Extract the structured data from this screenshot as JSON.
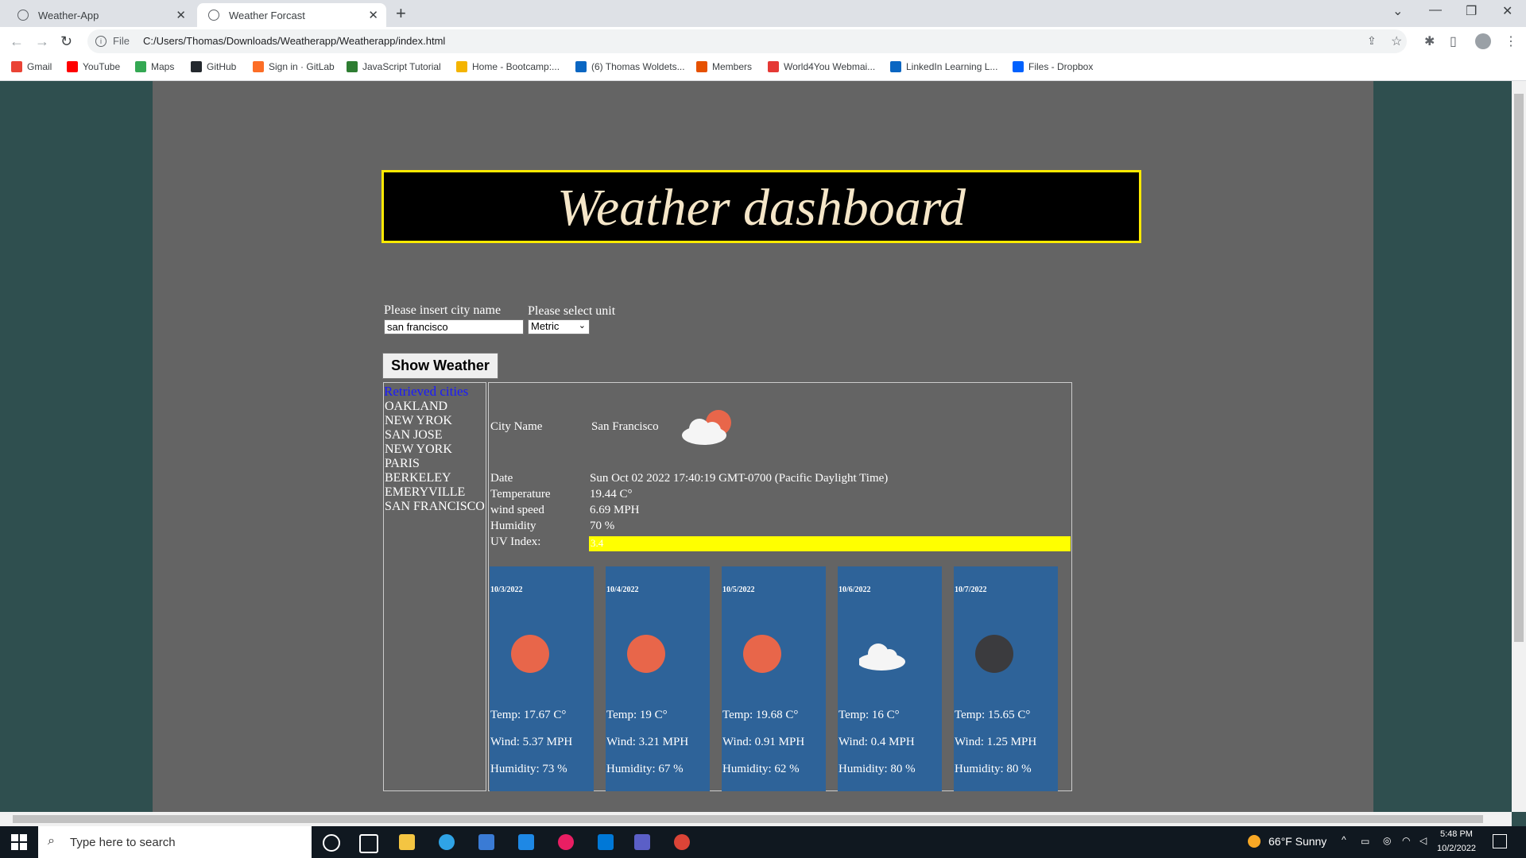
{
  "browser": {
    "tabs": [
      {
        "title": "Weather-App"
      },
      {
        "title": "Weather Forcast"
      }
    ],
    "url_scheme": "File",
    "url": "C:/Users/Thomas/Downloads/Weatherapp/Weatherapp/index.html",
    "bookmarks": [
      {
        "label": "Gmail",
        "color": "#ea4335"
      },
      {
        "label": "YouTube",
        "color": "#ff0000"
      },
      {
        "label": "Maps",
        "color": "#34a853"
      },
      {
        "label": "GitHub",
        "color": "#24292e"
      },
      {
        "label": "Sign in · GitLab",
        "color": "#fc6d26"
      },
      {
        "label": "JavaScript Tutorial",
        "color": "#2e7d32"
      },
      {
        "label": "Home - Bootcamp:...",
        "color": "#f4b400"
      },
      {
        "label": "(6) Thomas Woldets...",
        "color": "#0a66c2"
      },
      {
        "label": "Members",
        "color": "#e65100"
      },
      {
        "label": "World4You Webmai...",
        "color": "#e53935"
      },
      {
        "label": "LinkedIn Learning L...",
        "color": "#0a66c2"
      },
      {
        "label": "Files - Dropbox",
        "color": "#0061fe"
      }
    ]
  },
  "app": {
    "title": "Weather dashboard",
    "city_label": "Please insert city name",
    "city_value": "san francisco",
    "unit_label": "Please select unit",
    "unit_value": "Metric",
    "show_button": "Show Weather",
    "cities_heading": "Retrieved cities",
    "cities": [
      "OAKLAND",
      "NEW YROK",
      "SAN JOSE",
      "NEW YORK",
      "PARIS",
      "BERKELEY",
      "EMERYVILLE",
      "SAN FRANCISCO"
    ],
    "current": {
      "city_label": "City Name",
      "city": "San Francisco",
      "date_label": "Date",
      "date": "Sun Oct 02 2022 17:40:19 GMT-0700 (Pacific Daylight Time)",
      "temp_label": "Temperature",
      "temp": "19.44 C°",
      "wind_label": "wind speed",
      "wind": "6.69 MPH",
      "humidity_label": "Humidity",
      "humidity": "70 %",
      "uv_label": "UV Index:",
      "uv": "3.4",
      "uv_color": "#ffff00",
      "icon": "partly-cloudy-icon"
    },
    "forecast": [
      {
        "date": "10/3/2022",
        "icon": "sun-icon",
        "temp": "Temp: 17.67 C°",
        "wind": "Wind: 5.37 MPH",
        "humidity": "Humidity: 73 %"
      },
      {
        "date": "10/4/2022",
        "icon": "sun-icon",
        "temp": "Temp: 19 C°",
        "wind": "Wind: 3.21 MPH",
        "humidity": "Humidity: 67 %"
      },
      {
        "date": "10/5/2022",
        "icon": "sun-icon",
        "temp": "Temp: 19.68 C°",
        "wind": "Wind: 0.91 MPH",
        "humidity": "Humidity: 62 %"
      },
      {
        "date": "10/6/2022",
        "icon": "cloud-icon",
        "temp": "Temp: 16 C°",
        "wind": "Wind: 0.4 MPH",
        "humidity": "Humidity: 80 %"
      },
      {
        "date": "10/7/2022",
        "icon": "moon-icon",
        "temp": "Temp: 15.65 C°",
        "wind": "Wind: 1.25 MPH",
        "humidity": "Humidity: 80 %"
      }
    ]
  },
  "taskbar": {
    "search_placeholder": "Type here to search",
    "weather": "66°F  Sunny",
    "time": "5:48 PM",
    "date": "10/2/2022"
  }
}
